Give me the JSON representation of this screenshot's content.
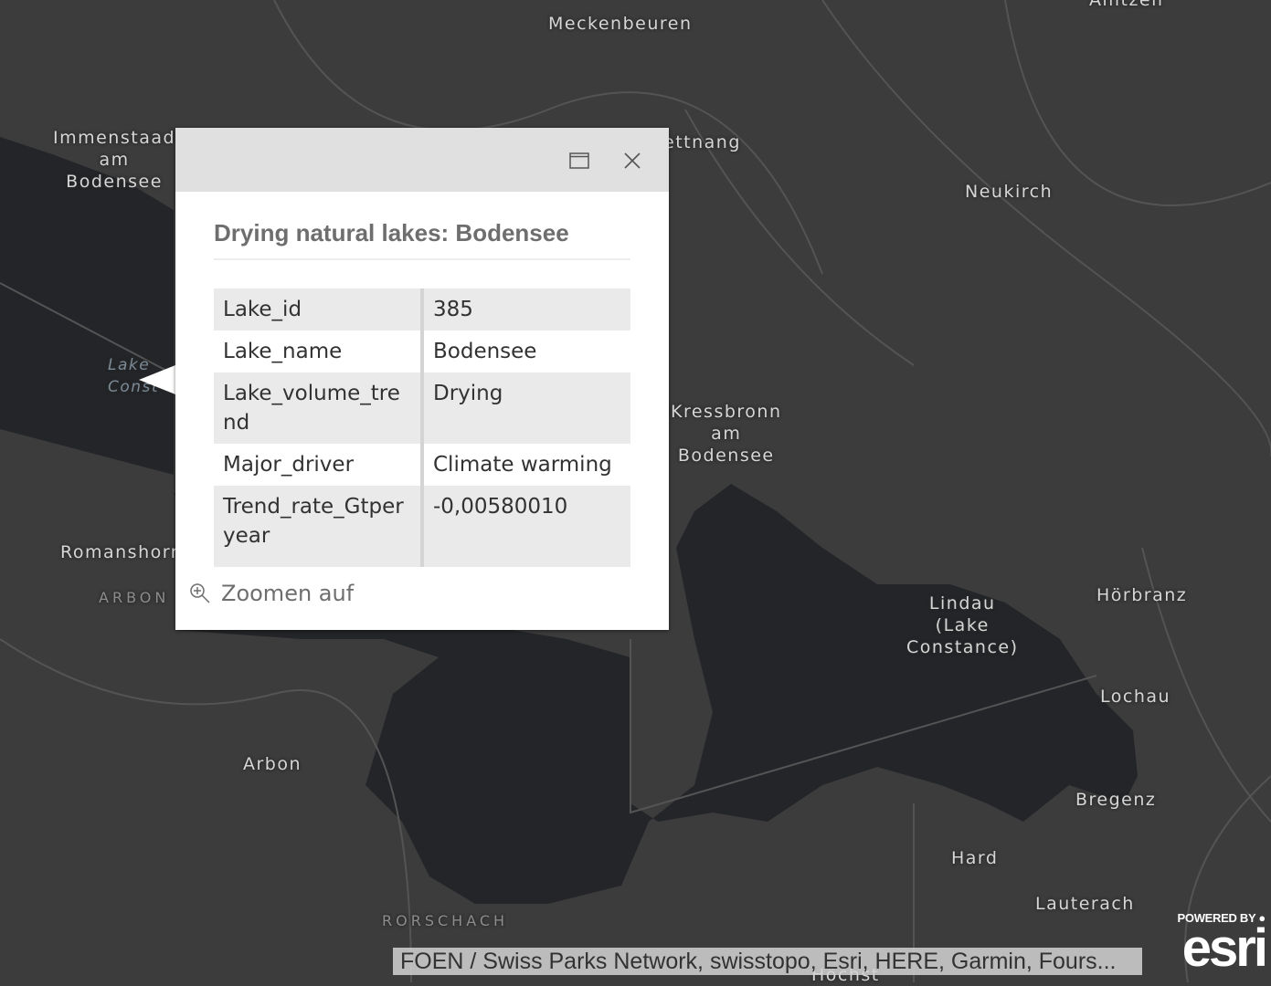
{
  "map": {
    "colors": {
      "land": "#3c3c3c",
      "water": "#232528",
      "roads": "#555555",
      "labels": "#d6d6d6"
    },
    "labels": [
      {
        "text": "Meckenbeuren",
        "style": "town"
      },
      {
        "text": "Immenstaad\nam\nBodensee",
        "style": "town"
      },
      {
        "text": "ettnang",
        "style": "town"
      },
      {
        "text": "Neukirch",
        "style": "town"
      },
      {
        "text": "Amtzell",
        "style": "town"
      },
      {
        "text": "Kressbronn\nam\nBodensee",
        "style": "town"
      },
      {
        "text": "Romanshorn",
        "style": "town"
      },
      {
        "text": "ARBON",
        "style": "region"
      },
      {
        "text": "Lindau\n(Lake\nConstance)",
        "style": "town"
      },
      {
        "text": "Hörbranz",
        "style": "town"
      },
      {
        "text": "Lochau",
        "style": "town"
      },
      {
        "text": "Arbon",
        "style": "town"
      },
      {
        "text": "Bregenz",
        "style": "town"
      },
      {
        "text": "Hard",
        "style": "town"
      },
      {
        "text": "Lauterach",
        "style": "town"
      },
      {
        "text": "RORSCHACH",
        "style": "region"
      },
      {
        "text": "Höchst",
        "style": "town"
      },
      {
        "text": "Lake\nConst",
        "style": "water"
      }
    ]
  },
  "popup": {
    "title": "Drying natural lakes: Bodensee",
    "dock_icon": "dock-window-icon",
    "close_icon": "close-icon",
    "fields": [
      {
        "key": "Lake_id",
        "value": "385"
      },
      {
        "key": "Lake_name",
        "value": "Bodensee"
      },
      {
        "key": "Lake_volume_trend",
        "value": "Drying"
      },
      {
        "key": "Major_driver",
        "value": "Climate warming"
      },
      {
        "key": "Trend_rate_Gtperyear",
        "value": "-0,00580010"
      }
    ],
    "zoom_label": "Zoomen auf",
    "zoom_icon": "zoom-in-icon"
  },
  "attribution": "FOEN / Swiss Parks Network, swisstopo, Esri, HERE, Garmin, Fours...",
  "esri": {
    "powered_by": "POWERED BY",
    "logo": "esri"
  }
}
